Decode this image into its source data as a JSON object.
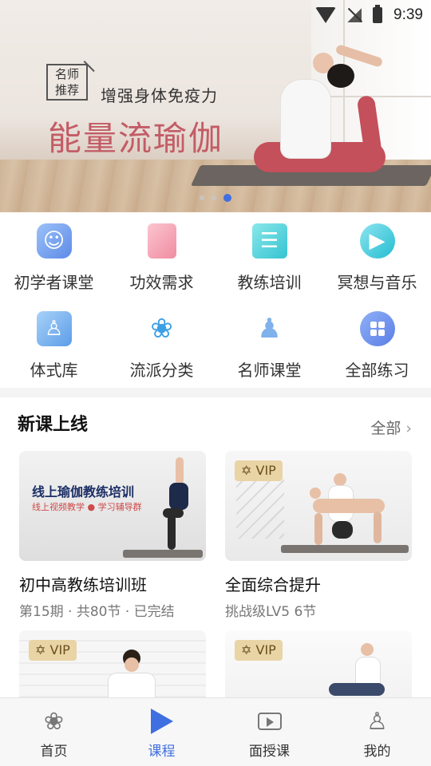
{
  "status": {
    "time": "9:39"
  },
  "banner": {
    "tag": "名师推荐",
    "tag_line1": "名师",
    "tag_line2": "推荐",
    "tagline": "增强身体免疫力",
    "title": "能量流瑜伽",
    "dots": 3,
    "active_dot": 3
  },
  "categories": [
    {
      "label": "初学者课堂",
      "icon": "beginner-icon"
    },
    {
      "label": "功效需求",
      "icon": "yoga-mat-icon"
    },
    {
      "label": "教练培训",
      "icon": "coach-training-icon"
    },
    {
      "label": "冥想与音乐",
      "icon": "meditation-music-icon"
    },
    {
      "label": "体式库",
      "icon": "pose-library-icon"
    },
    {
      "label": "流派分类",
      "icon": "lotus-icon"
    },
    {
      "label": "名师课堂",
      "icon": "master-class-icon"
    },
    {
      "label": "全部练习",
      "icon": "all-practice-icon"
    }
  ],
  "new_courses": {
    "title": "新课上线",
    "more": "全部",
    "cards": [
      {
        "title": "初中高教练培训班",
        "meta": "第15期 · 共80节 · 已完结",
        "thumb_title": "线上瑜伽教练培训",
        "thumb_sub": "线上视频教学 ● 学习辅导群",
        "vip": ""
      },
      {
        "title": "全面综合提升",
        "meta": "挑战级LV5    6节",
        "vip": "VIP"
      },
      {
        "title": "",
        "meta": "",
        "vip": "VIP"
      },
      {
        "title": "",
        "meta": "",
        "vip": "VIP"
      }
    ]
  },
  "nav": [
    {
      "label": "首页",
      "icon": "lotus-icon"
    },
    {
      "label": "课程",
      "icon": "play-icon",
      "active": true
    },
    {
      "label": "面授课",
      "icon": "video-camera-icon"
    },
    {
      "label": "我的",
      "icon": "meditation-person-icon"
    }
  ],
  "colors": {
    "accent": "#3f6fe0",
    "title_pink": "#c35c66",
    "vip_gold": "#e9d4a6"
  }
}
